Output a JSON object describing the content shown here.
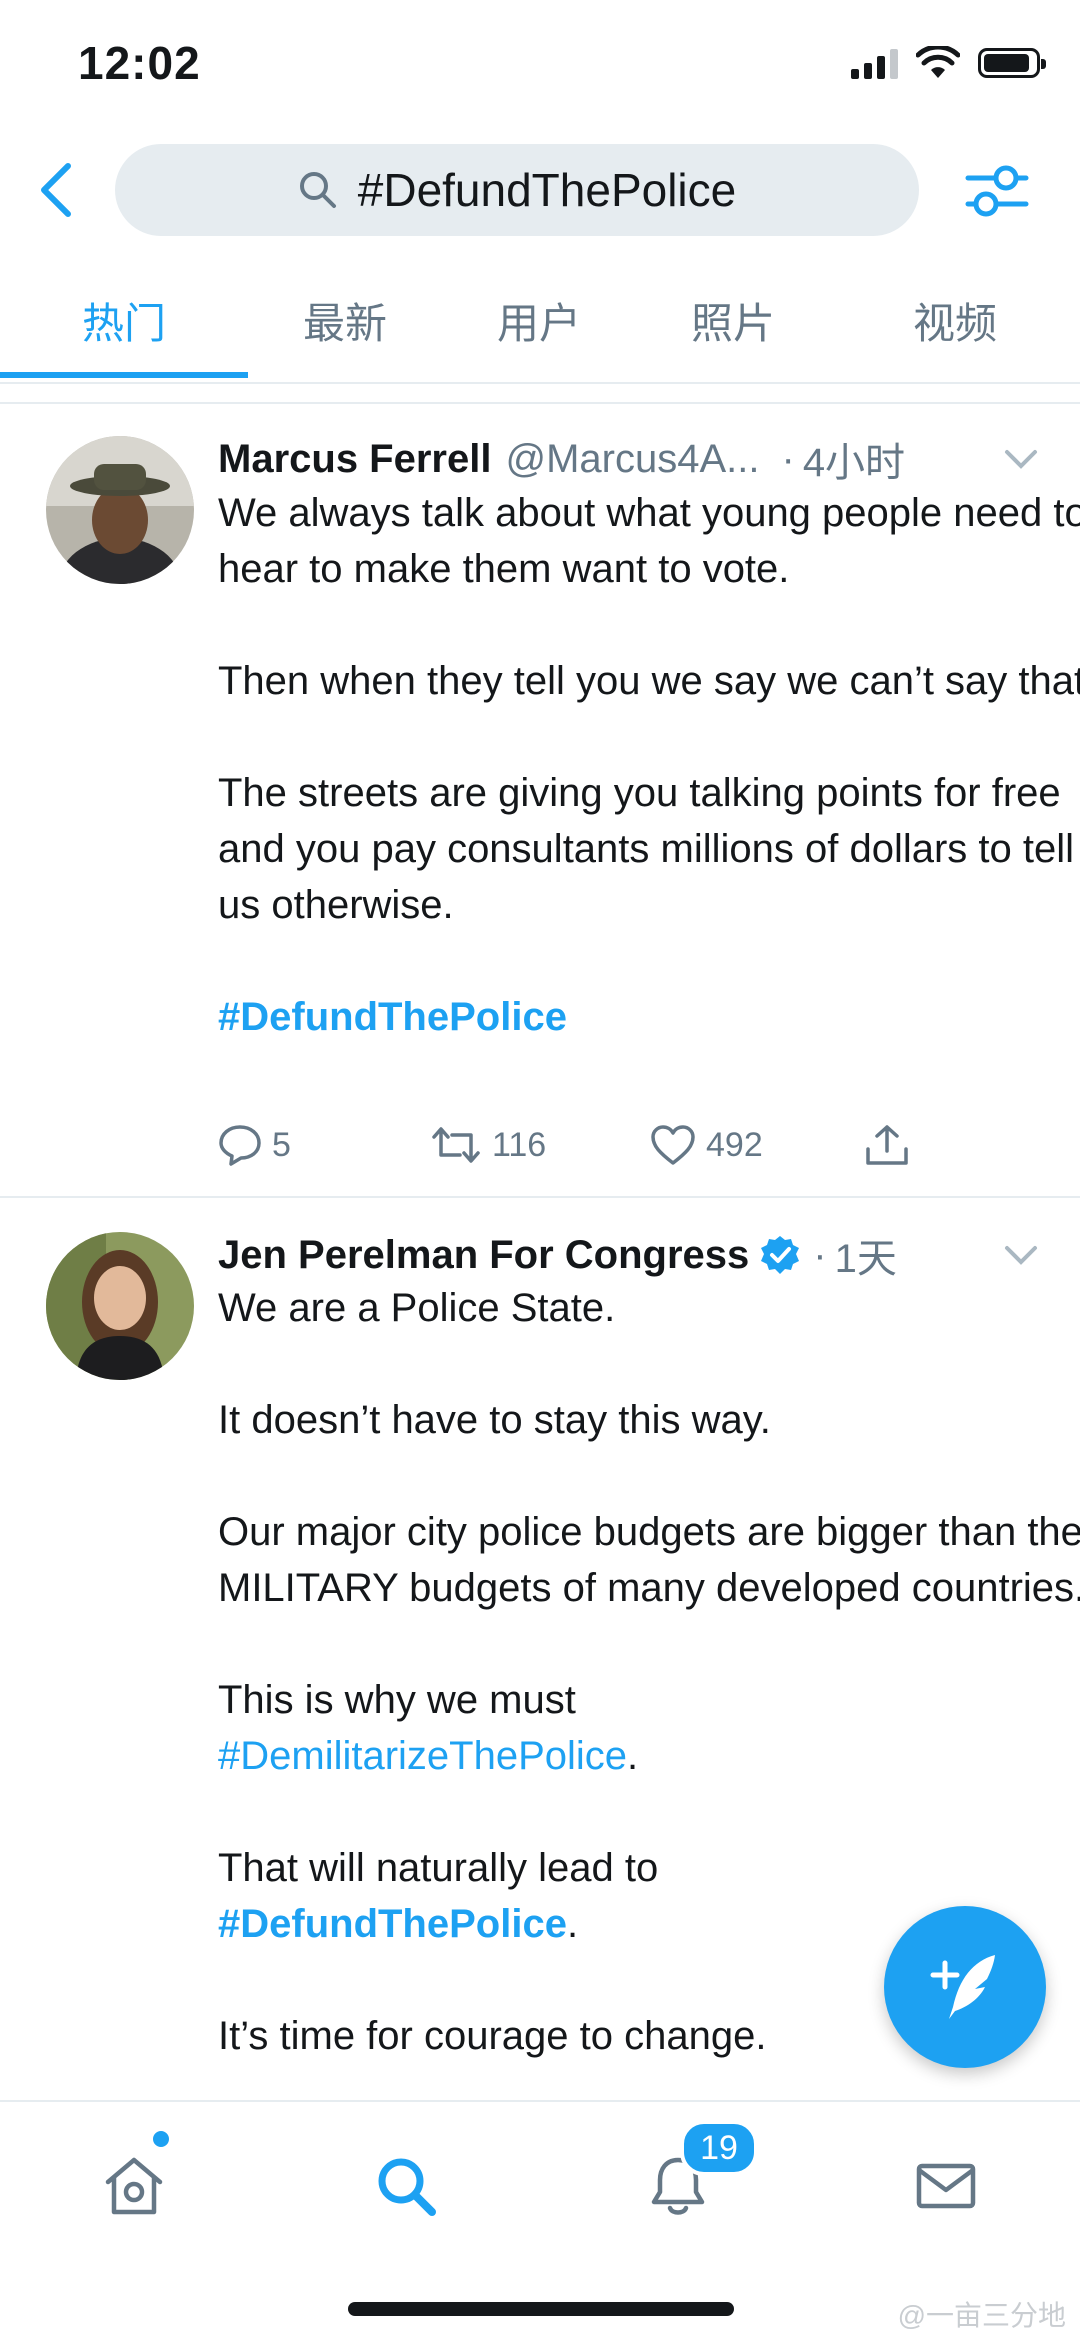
{
  "status_bar": {
    "time": "12:02"
  },
  "search": {
    "query": "#DefundThePolice"
  },
  "tabs": [
    {
      "label": "热门",
      "active": true
    },
    {
      "label": "最新",
      "active": false
    },
    {
      "label": "用户",
      "active": false
    },
    {
      "label": "照片",
      "active": false
    },
    {
      "label": "视频",
      "active": false
    }
  ],
  "tweets": [
    {
      "name": "Marcus Ferrell",
      "handle": "@Marcus4A...",
      "time": "4小时",
      "paragraphs": [
        "We always talk about what young people need to hear to make them want to vote.",
        "Then when they tell you we say we can’t say that.",
        "The streets are giving you talking points for free and you pay consultants millions of dollars to tell us otherwise.",
        "#DefundThePolice"
      ],
      "replies": "5",
      "retweets": "116",
      "likes": "492"
    },
    {
      "name": "Jen Perelman For Congress",
      "verified": true,
      "time": "1天",
      "p1": "We are a Police State.",
      "p2": "It doesn’t have to stay this way.",
      "p3": "Our major city police budgets are bigger than the MILITARY budgets of many developed countries.",
      "p4_text": "This is why we must",
      "p4_tag": "#DemilitarizeThePolice",
      "p4_end": ".",
      "p5_text": "That will naturally lead to",
      "p5_tag": "#DefundThePolice",
      "p5_end": ".",
      "p6": "It’s time for courage to change."
    }
  ],
  "notifications_badge": "19",
  "watermark": "@一亩三分地",
  "icons": {
    "back": "chevron-left-icon",
    "search": "search-icon",
    "filter": "sliders-icon",
    "compose": "compose-tweet-icon",
    "home": "home-icon",
    "explore": "search-icon",
    "notifications": "bell-icon",
    "messages": "envelope-icon"
  },
  "colors": {
    "accent": "#1da1f2",
    "text": "#14171a",
    "muted": "#657786"
  }
}
